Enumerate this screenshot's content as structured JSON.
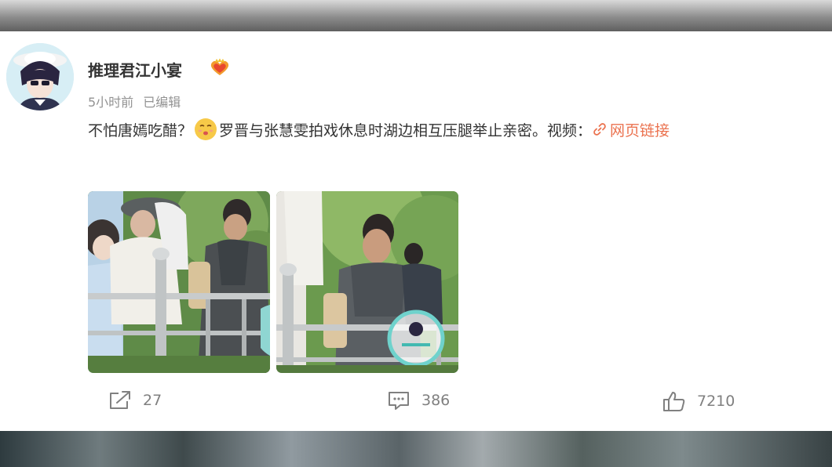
{
  "post": {
    "username": "推理君江小宴",
    "time": "5小时前",
    "edited": "已编辑",
    "text_before_emoji": "不怕唐嫣吃醋？",
    "text_after_emoji": "罗晋与张慧雯拍戏休息时湖边相互压腿举止亲密。视频：",
    "link_label": "网页链接",
    "images": [
      "photo-1",
      "photo-2"
    ]
  },
  "actions": {
    "repost_count": "27",
    "comment_count": "386",
    "like_count": "7210"
  },
  "icons": {
    "badge": "heart-crown-badge-icon",
    "emoji": "pouting-face-emoji",
    "link": "chain-link-icon",
    "repost": "share-arrow-icon",
    "comment": "comment-bubble-icon",
    "like": "thumbs-up-icon"
  },
  "colors": {
    "link": "#eb7350",
    "meta": "#939393",
    "text": "#333333",
    "action": "#808080"
  }
}
